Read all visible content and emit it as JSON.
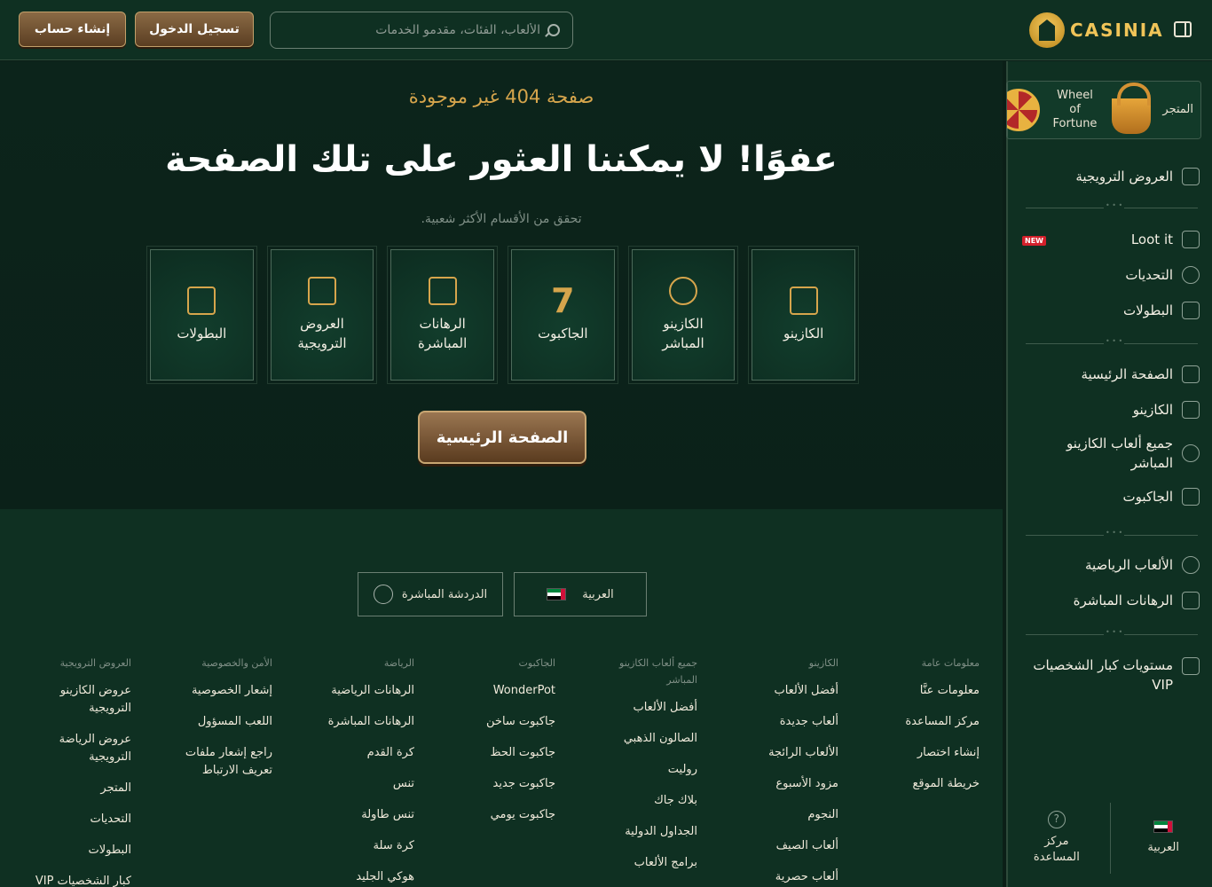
{
  "header": {
    "logo_text": "CASINIA",
    "search_placeholder": "الألعاب، الفئات، مقدمو الخدمات",
    "login_label": "تسجيل الدخول",
    "signup_label": "إنشاء حساب"
  },
  "sidebar": {
    "promo_tiles": [
      {
        "label": "المتجر",
        "icon": "basket-icon"
      },
      {
        "label": "Wheel of Fortune",
        "icon": "wheel-of-fortune-icon"
      }
    ],
    "group1": [
      {
        "label": "العروض الترويجية",
        "icon": "gift-box-icon"
      }
    ],
    "group2": [
      {
        "label": "Loot it",
        "icon": "cube-icon",
        "badge": "NEW"
      },
      {
        "label": "التحديات",
        "icon": "bell-icon"
      },
      {
        "label": "البطولات",
        "icon": "trophy-icon"
      }
    ],
    "group3": [
      {
        "label": "الصفحة الرئيسية",
        "icon": "castle-icon"
      },
      {
        "label": "الكازينو",
        "icon": "casino-icon"
      },
      {
        "label": "جميع ألعاب الكازينو المباشر",
        "icon": "chip-icon"
      },
      {
        "label": "الجاكبوت",
        "icon": "seven-icon"
      }
    ],
    "group4": [
      {
        "label": "الألعاب الرياضية",
        "icon": "soccer-ball-icon"
      },
      {
        "label": "الرهانات المباشرة",
        "icon": "live-bet-icon"
      }
    ],
    "group5": [
      {
        "label": "مستويات كبار الشخصيات VIP",
        "icon": "crown-icon"
      }
    ],
    "bottom": {
      "language_label": "العربية",
      "help_label": "مركز المساعدة"
    }
  },
  "main": {
    "subtitle": "صفحة 404 غير موجودة",
    "title": "عفوًا! لا يمكننا العثور على تلك الصفحة",
    "hint": "تحقق من الأقسام الأكثر شعبية.",
    "cards": [
      {
        "label": "الكازينو",
        "icon": "casino-icon"
      },
      {
        "label": "الكازينو المباشر",
        "icon": "chip-icon"
      },
      {
        "label": "الجاكبوت",
        "icon": "seven-icon"
      },
      {
        "label": "الرهانات المباشرة",
        "icon": "live-bet-icon"
      },
      {
        "label": "العروض الترويجية",
        "icon": "treasure-chest-icon"
      },
      {
        "label": "البطولات",
        "icon": "trophy-icon"
      }
    ],
    "home_button": "الصفحة الرئيسية"
  },
  "footer": {
    "language_label": "العربية",
    "chat_label": "الدردشة المباشرة",
    "columns": [
      {
        "title": "معلومات عامة",
        "links": [
          "معلومات عنَّا",
          "مركز المساعدة",
          "إنشاء اختصار",
          "خريطة الموقع"
        ]
      },
      {
        "title": "الكازينو",
        "links": [
          "أفضل الألعاب",
          "ألعاب جديدة",
          "الألعاب الرائجة",
          "مزود الأسبوع",
          "النجوم",
          "ألعاب الصيف",
          "ألعاب حصرية"
        ]
      },
      {
        "title": "جميع ألعاب الكازينو المباشر",
        "links": [
          "أفضل الألعاب",
          "الصالون الذهبي",
          "روليت",
          "بلاك جاك",
          "الجداول الدولية",
          "برامج الألعاب"
        ]
      },
      {
        "title": "الجاكبوت",
        "links": [
          "WonderPot",
          "جاكبوت ساخن",
          "جاكبوت الحظ",
          "جاكبوت جديد",
          "جاكبوت يومي"
        ]
      },
      {
        "title": "الرياضة",
        "links": [
          "الرهانات الرياضية",
          "الرهانات المباشرة",
          "كرة القدم",
          "تنس",
          "تنس طاولة",
          "كرة سلة",
          "هوكي الجليد"
        ]
      },
      {
        "title": "الأمن والخصوصية",
        "links": [
          "إشعار الخصوصية",
          "اللعب المسؤول",
          "راجع إشعار ملفات تعريف الارتباط"
        ]
      },
      {
        "title": "العروض الترويجية",
        "links": [
          "عروض الكازينو الترويجية",
          "عروض الرياضة الترويجية",
          "المتجر",
          "التحديات",
          "البطولات",
          "كبار الشخصيات VIP"
        ]
      }
    ]
  }
}
